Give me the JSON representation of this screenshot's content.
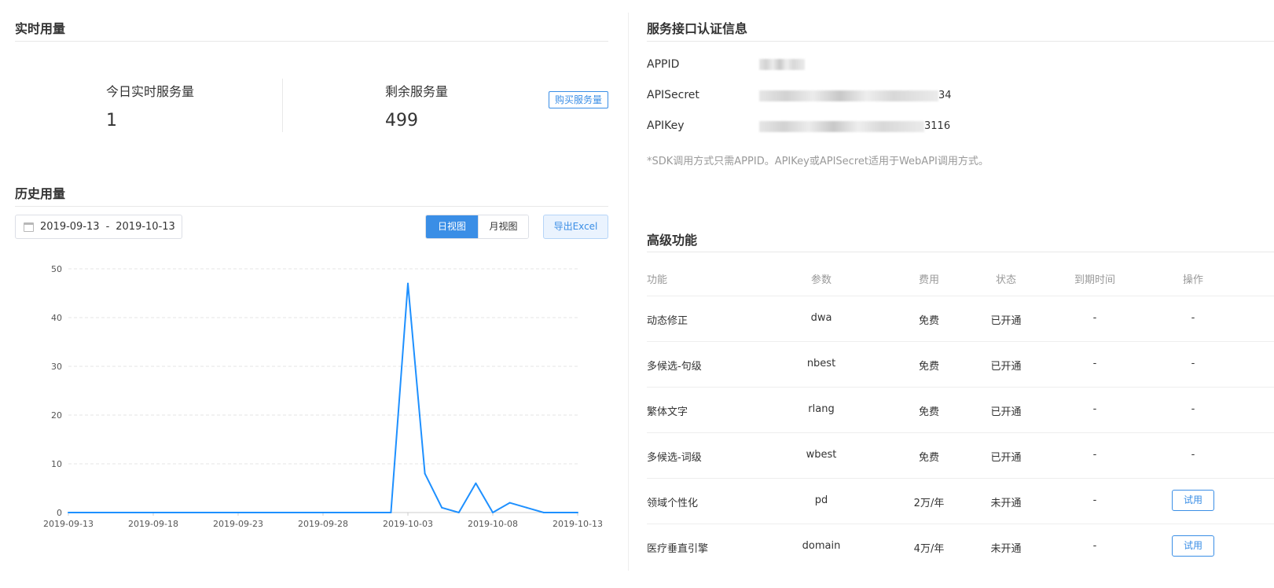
{
  "realtime": {
    "title": "实时用量",
    "today_label": "今日实时服务量",
    "today_value": "1",
    "remaining_label": "剩余服务量",
    "remaining_value": "499",
    "buy_button": "购买服务量"
  },
  "history": {
    "title": "历史用量",
    "date_start": "2019-09-13",
    "date_sep": "-",
    "date_end": "2019-10-13",
    "day_view": "日视图",
    "month_view": "月视图",
    "export": "导出Excel"
  },
  "chart_data": {
    "type": "line",
    "x_tick_labels": [
      "2019-09-13",
      "2019-09-18",
      "2019-09-23",
      "2019-09-28",
      "2019-10-03",
      "2019-10-08",
      "2019-10-13"
    ],
    "x": [
      "2019-09-13",
      "2019-09-14",
      "2019-09-15",
      "2019-09-16",
      "2019-09-17",
      "2019-09-18",
      "2019-09-19",
      "2019-09-20",
      "2019-09-21",
      "2019-09-22",
      "2019-09-23",
      "2019-09-24",
      "2019-09-25",
      "2019-09-26",
      "2019-09-27",
      "2019-09-28",
      "2019-09-29",
      "2019-09-30",
      "2019-10-01",
      "2019-10-02",
      "2019-10-03",
      "2019-10-04",
      "2019-10-05",
      "2019-10-06",
      "2019-10-07",
      "2019-10-08",
      "2019-10-09",
      "2019-10-10",
      "2019-10-11",
      "2019-10-12",
      "2019-10-13"
    ],
    "values": [
      0,
      0,
      0,
      0,
      0,
      0,
      0,
      0,
      0,
      0,
      0,
      0,
      0,
      0,
      0,
      0,
      0,
      0,
      0,
      0,
      47,
      8,
      1,
      0,
      6,
      0,
      2,
      1,
      0,
      0,
      0
    ],
    "y_ticks": [
      0,
      10,
      20,
      30,
      40,
      50
    ],
    "ylim": [
      0,
      50
    ],
    "grid": "horizontal dashed",
    "color": "#1e90ff"
  },
  "credentials": {
    "title": "服务接口认证信息",
    "appid_label": "APPID",
    "apisecret_label": "APISecret",
    "apisecret_suffix": "34",
    "apikey_label": "APIKey",
    "apikey_suffix": "3116",
    "note": "*SDK调用方式只需APPID。APIKey或APISecret适用于WebAPI调用方式。"
  },
  "advanced": {
    "title": "高级功能",
    "headers": [
      "功能",
      "参数",
      "费用",
      "状态",
      "到期时间",
      "操作"
    ],
    "rows": [
      {
        "name": "动态修正",
        "param": "dwa",
        "fee": "免费",
        "status": "已开通",
        "expire": "-",
        "action": "-"
      },
      {
        "name": "多候选-句级",
        "param": "nbest",
        "fee": "免费",
        "status": "已开通",
        "expire": "-",
        "action": "-"
      },
      {
        "name": "繁体文字",
        "param": "rlang",
        "fee": "免费",
        "status": "已开通",
        "expire": "-",
        "action": "-"
      },
      {
        "name": "多候选-词级",
        "param": "wbest",
        "fee": "免费",
        "status": "已开通",
        "expire": "-",
        "action": "-"
      },
      {
        "name": "领域个性化",
        "param": "pd",
        "fee": "2万/年",
        "status": "未开通",
        "expire": "-",
        "action": "试用"
      },
      {
        "name": "医疗垂直引擎",
        "param": "domain",
        "fee": "4万/年",
        "status": "未开通",
        "expire": "-",
        "action": "试用"
      }
    ]
  }
}
